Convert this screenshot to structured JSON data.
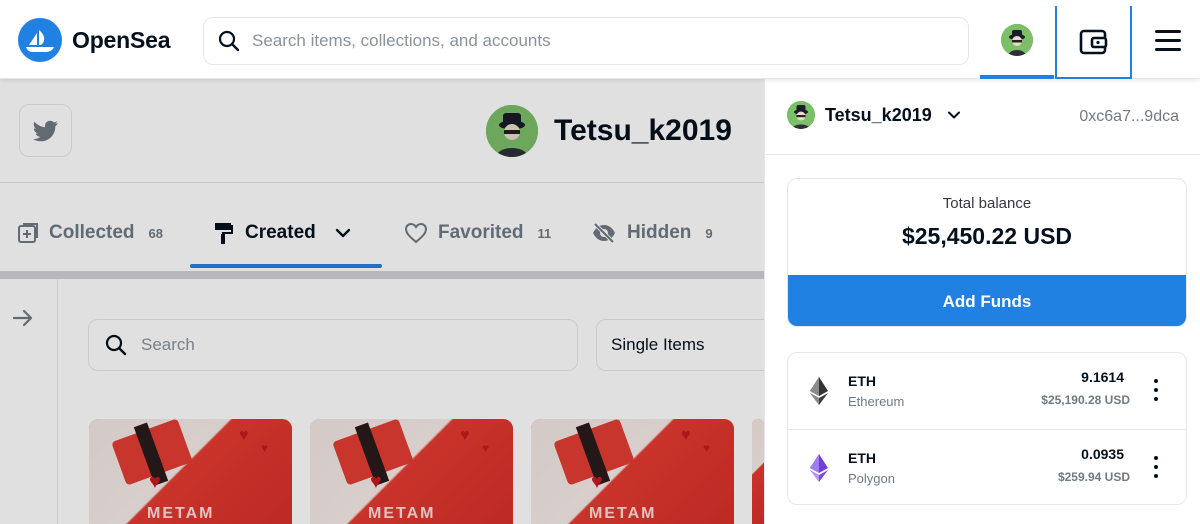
{
  "nav": {
    "brand": "OpenSea",
    "search_placeholder": "Search items, collections, and accounts"
  },
  "profile": {
    "username": "Tetsu_k2019"
  },
  "tabs": [
    {
      "label": "Collected",
      "count": "68"
    },
    {
      "label": "Created",
      "count": ""
    },
    {
      "label": "Favorited",
      "count": "11"
    },
    {
      "label": "Hidden",
      "count": "9"
    }
  ],
  "filters": {
    "search_placeholder": "Search",
    "select_value": "Single Items"
  },
  "cards": [
    {
      "label": "METAM"
    },
    {
      "label": "METAM"
    },
    {
      "label": "METAM"
    }
  ],
  "wallet": {
    "username": "Tetsu_k2019",
    "address": "0xc6a7...9dca",
    "balance_label": "Total balance",
    "balance_value": "$25,450.22 USD",
    "add_funds_label": "Add Funds",
    "tokens": [
      {
        "symbol": "ETH",
        "network": "Ethereum",
        "amount": "9.1614",
        "usd": "$25,190.28 USD",
        "icon": "ethereum-icon"
      },
      {
        "symbol": "ETH",
        "network": "Polygon",
        "amount": "0.0935",
        "usd": "$259.94 USD",
        "icon": "polygon-eth-icon"
      }
    ]
  },
  "colors": {
    "accent": "#2081e2",
    "text": "#04111d",
    "muted": "#707a83"
  }
}
